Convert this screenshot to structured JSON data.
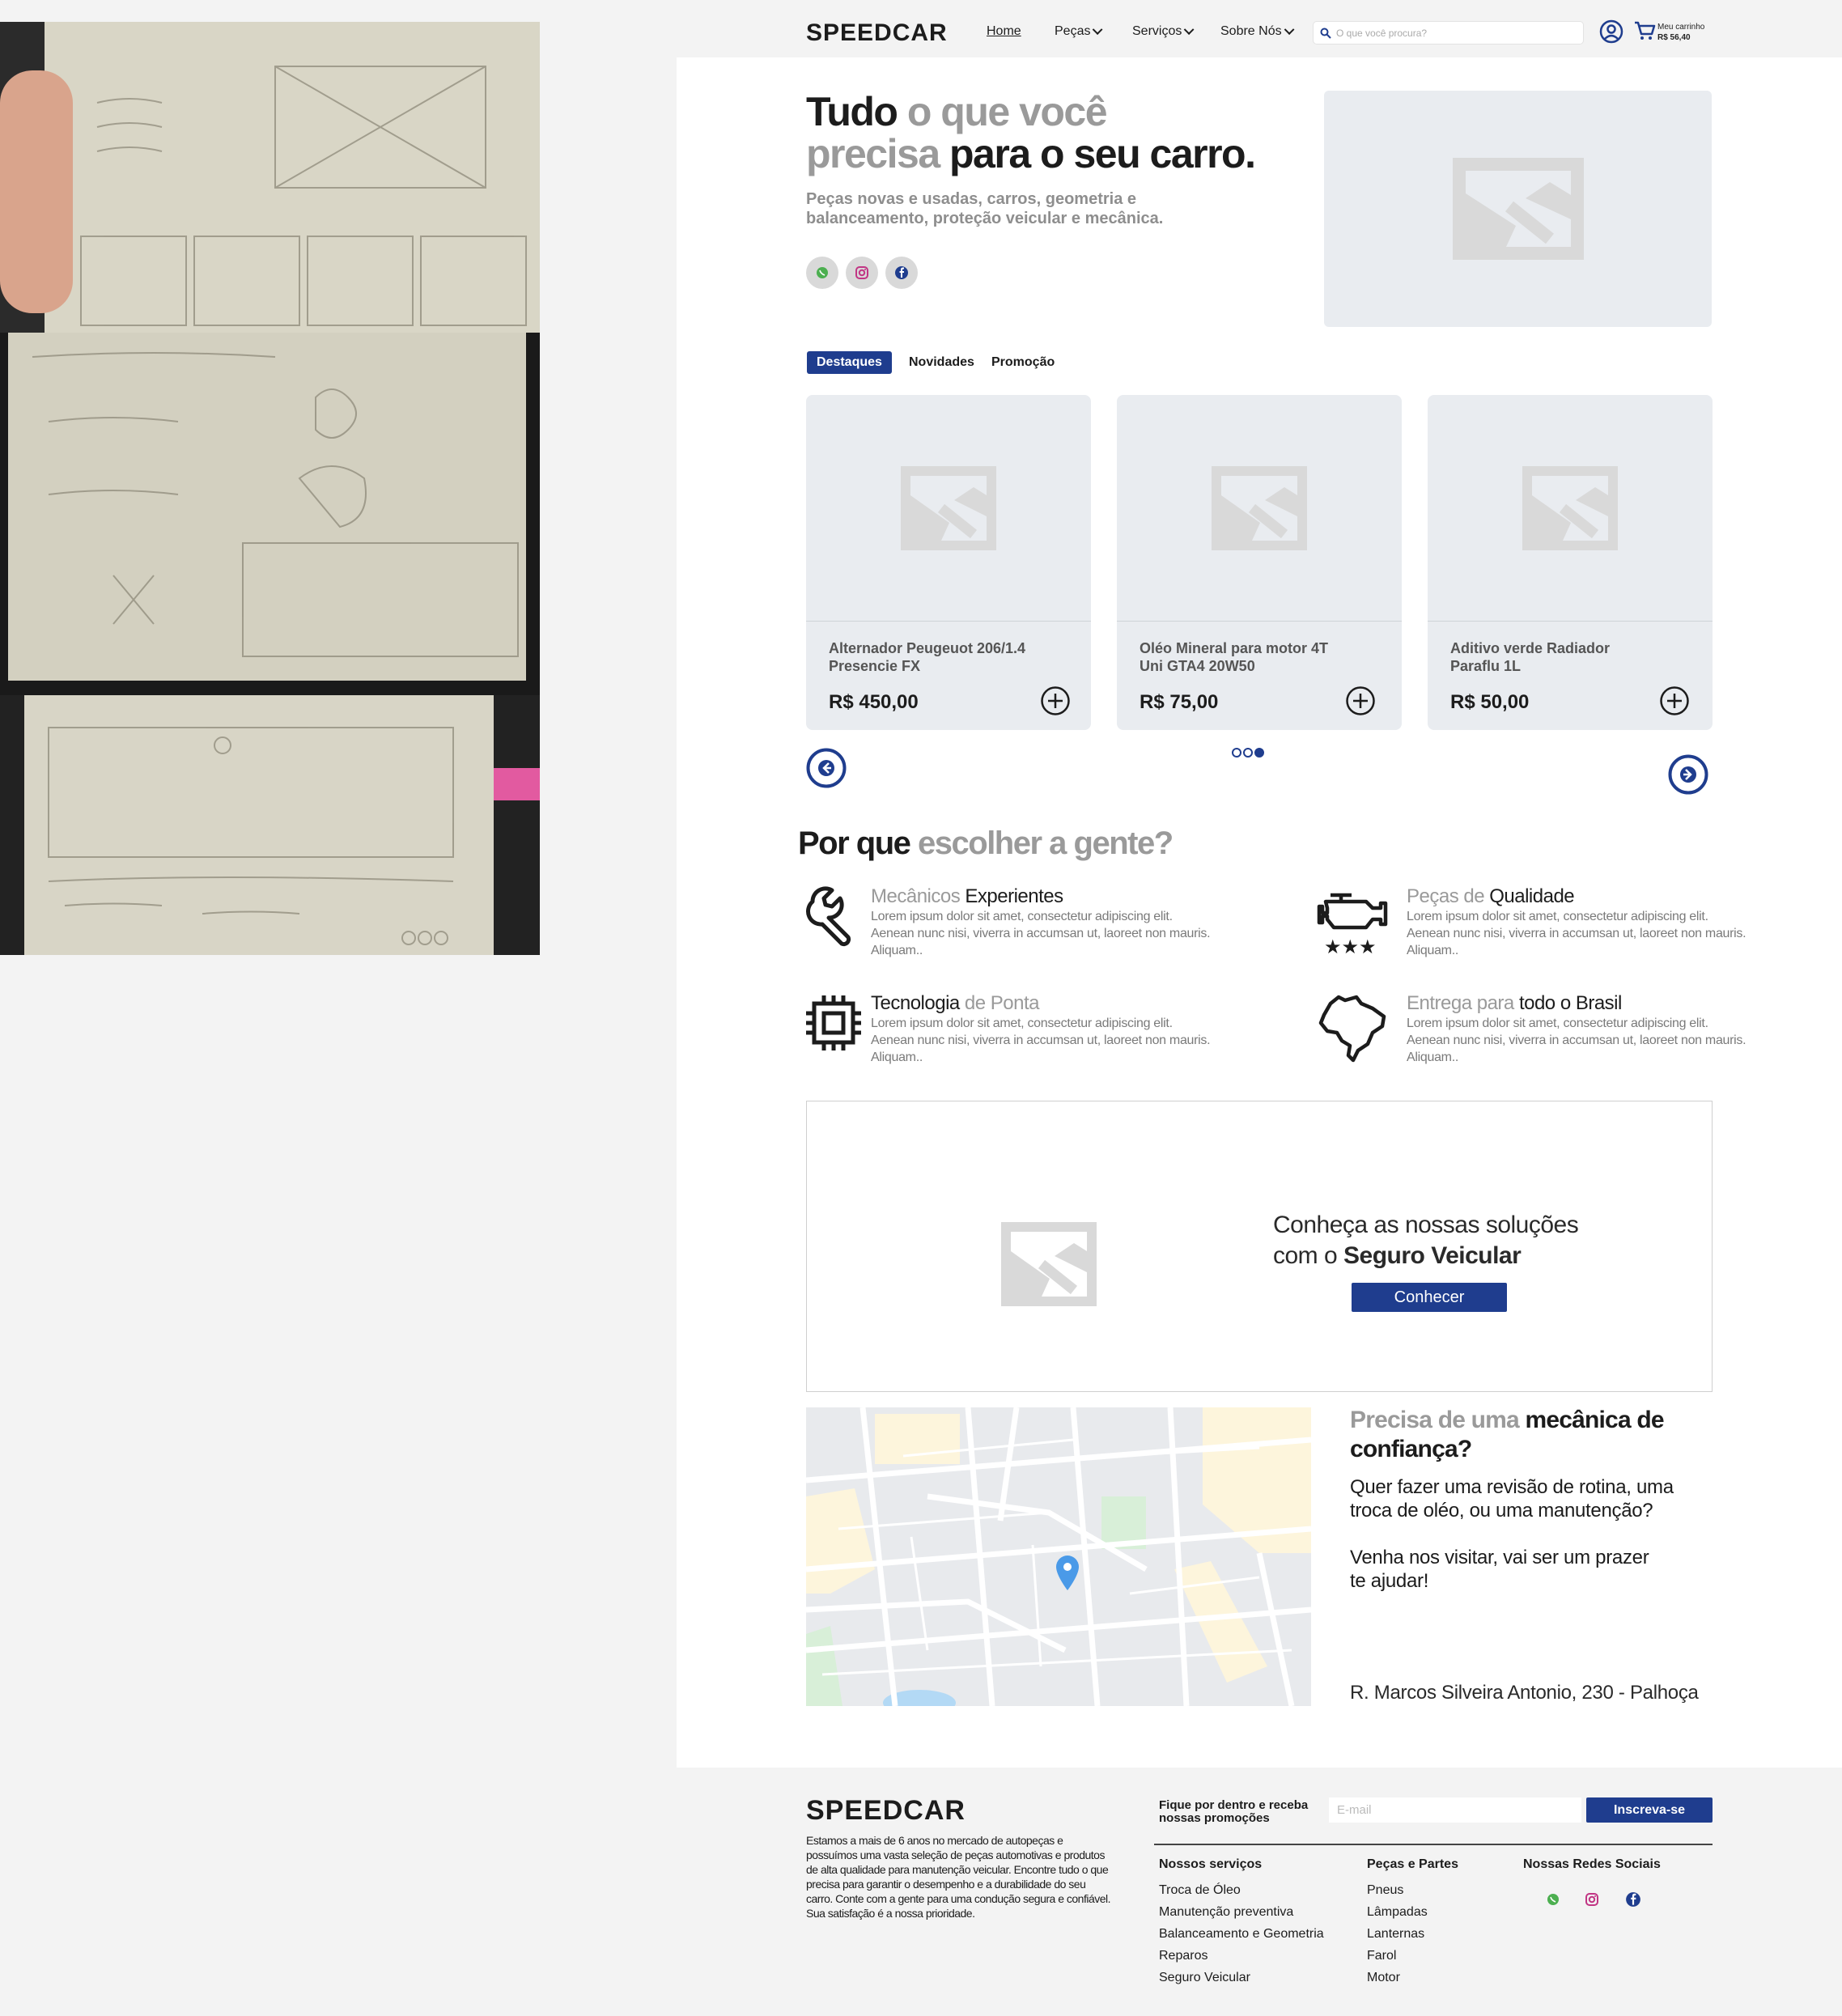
{
  "header": {
    "logo": "SPEEDCAR",
    "nav": [
      {
        "label": "Home"
      },
      {
        "label": "Peças"
      },
      {
        "label": "Serviços"
      },
      {
        "label": "Sobre Nós"
      }
    ],
    "search_placeholder": "O que você procura?",
    "cart_label": "Meu carrinho",
    "cart_total": "R$ 56,40"
  },
  "hero": {
    "title_dark_1": "Tudo",
    "title_grey_1": " o que você",
    "title_grey_2": "precisa",
    "title_dark_2": " para o seu carro.",
    "subtitle": "Peças novas e usadas, carros, geometria e balanceamento, proteção veicular e mecânica.",
    "social": [
      {
        "icon": "whatsapp-icon",
        "color": "#4caf50"
      },
      {
        "icon": "instagram-icon",
        "color": "#c13584"
      },
      {
        "icon": "facebook-icon",
        "color": "#1f3d8e"
      }
    ]
  },
  "tabs": [
    {
      "label": "Destaques",
      "active": true
    },
    {
      "label": "Novidades",
      "active": false
    },
    {
      "label": "Promoção",
      "active": false
    }
  ],
  "products": [
    {
      "name": "Alternador Peugeuot 206/1.4 Presencie FX",
      "price": "R$ 450,00"
    },
    {
      "name": "Oléo Mineral para motor 4T Uni GTA4 20W50",
      "price": "R$ 75,00"
    },
    {
      "name": "Aditivo verde Radiador Paraflu 1L",
      "price": "R$ 50,00"
    }
  ],
  "carousel": {
    "pages": 3,
    "current": 3
  },
  "why": {
    "title_dark": "Por que",
    "title_grey": " escolher a gente?",
    "features": [
      {
        "grey": "Mecânicos ",
        "dark": "Experientes",
        "grey_after": "",
        "text": "Lorem ipsum dolor sit amet, consectetur adipiscing elit. Aenean nunc nisi, viverra in accumsan ut, laoreet non mauris. Aliquam..",
        "icon": "wrench-icon"
      },
      {
        "grey": "Peças de ",
        "dark": "Qualidade",
        "grey_after": "",
        "text": "Lorem ipsum dolor sit amet, consectetur adipiscing elit. Aenean nunc nisi, viverra in accumsan ut, laoreet non mauris. Aliquam..",
        "icon": "engine-stars-icon"
      },
      {
        "grey": "",
        "dark": "Tecnologia",
        "grey_after": " de Ponta",
        "text": "Lorem ipsum dolor sit amet, consectetur adipiscing elit. Aenean nunc nisi, viverra in accumsan ut, laoreet non mauris. Aliquam..",
        "icon": "chip-icon"
      },
      {
        "grey": "Entrega para ",
        "dark": "todo o Brasil",
        "grey_after": "",
        "text": "Lorem ipsum dolor sit amet, consectetur adipiscing elit. Aenean nunc nisi, viverra in accumsan ut, laoreet non mauris. Aliquam..",
        "icon": "brazil-map-icon"
      }
    ]
  },
  "banner": {
    "line1": "Conheça as nossas soluções",
    "line2_prefix": "com o ",
    "line2_bold": "Seguro Veicular",
    "button": "Conhecer"
  },
  "mechanic": {
    "title_grey": "Precisa de uma",
    "title_dark": " mecânica de confiança?",
    "text1": "Quer fazer uma revisão de rotina, uma troca de oléo, ou uma manutenção?",
    "text2": "Venha nos visitar, vai ser um prazer te ajudar!",
    "address": "R. Marcos Silveira Antonio, 230 - Palhoça"
  },
  "footer": {
    "logo": "SPEEDCAR",
    "about": "Estamos a mais de 6 anos no mercado de autopeças e possuímos uma vasta seleção de peças automotivas e produtos de alta qualidade para manutenção veicular. Encontre tudo o que precisa para garantir o desempenho e a durabilidade do seu carro. Conte com a gente para uma condução segura e confiável. Sua satisfação é a nossa prioridade.",
    "newsletter_label": "Fique por dentro e receba nossas promoções",
    "email_placeholder": "E-mail",
    "subscribe": "Inscreva-se",
    "services_title": "Nossos serviços",
    "services": [
      "Troca de Óleo",
      "Manutenção preventiva",
      "Balanceamento e Geometria",
      "Reparos",
      "Seguro Veicular"
    ],
    "parts_title": "Peças e Partes",
    "parts": [
      "Pneus",
      "Lâmpadas",
      "Lanternas",
      "Farol",
      "Motor"
    ],
    "social_title": "Nossas Redes Sociais"
  },
  "colors": {
    "accent": "#1f3d8e",
    "placeholder_bg": "#e9ecf0",
    "placeholder_icon": "#d9d9d9",
    "grey_text": "#9a9a9a"
  }
}
